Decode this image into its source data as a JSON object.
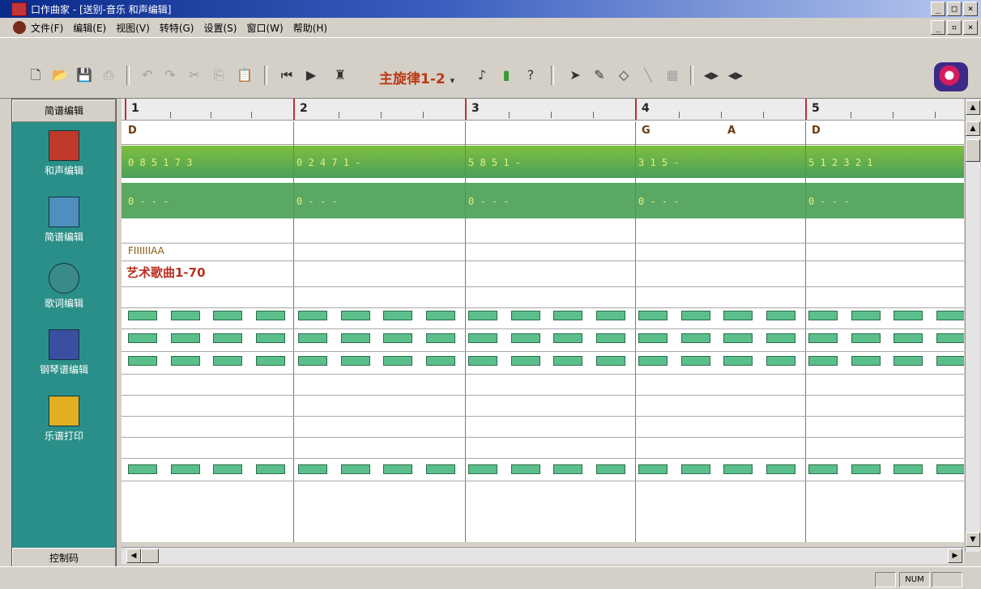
{
  "window": {
    "title": "口作曲家 - [送别-音乐 和声编辑]",
    "minimize": "_",
    "maximize": "□",
    "close": "×"
  },
  "menu": {
    "items": [
      {
        "label": "文件(F)"
      },
      {
        "label": "编辑(E)"
      },
      {
        "label": "视图(V)"
      },
      {
        "label": "转特(G)"
      },
      {
        "label": "设置(S)"
      },
      {
        "label": "窗口(W)"
      },
      {
        "label": "帮助(H)"
      }
    ],
    "doc_buttons": [
      "_",
      "▫",
      "×"
    ]
  },
  "toolbar": {
    "melody_selector": "主旋律1-2",
    "icons": [
      "new-icon",
      "open-icon",
      "save-icon",
      "print-icon",
      "undo-icon",
      "redo-icon",
      "cut-icon",
      "copy-icon",
      "paste-icon",
      "rewind-icon",
      "play-icon",
      "track-icon",
      "select-icon",
      "pencil-icon",
      "eraser-icon",
      "line-icon",
      "grid-icon",
      "zoom-in-icon",
      "zoom-out-icon"
    ]
  },
  "sidebar": {
    "header": "简谱编辑",
    "footer": "控制码",
    "items": [
      {
        "label": "和声编辑",
        "icon": "harmony-icon",
        "color": "#c0392b"
      },
      {
        "label": "简谱编辑",
        "icon": "notation-icon",
        "color": "#4f8fbf"
      },
      {
        "label": "歌词编辑",
        "icon": "lyrics-icon",
        "color": "#3a8a8a"
      },
      {
        "label": "钢琴谱编辑",
        "icon": "piano-score-icon",
        "color": "#3b4fa0"
      },
      {
        "label": "乐谱打印",
        "icon": "print-score-icon",
        "color": "#e0b020"
      }
    ]
  },
  "editor": {
    "bars": [
      "1",
      "2",
      "3",
      "4",
      "5"
    ],
    "chords": [
      "D",
      "G",
      "A",
      "D"
    ],
    "melody_row_1": [
      "0  8 5 1   7 3",
      "0 2 4 7 1   -",
      "5  8 5 1    -",
      "3  1   5   -",
      "5  1 2 3  2 1"
    ],
    "melody_row_2": [
      "0  -   -   -",
      "0  -   -   -",
      "0  -   -   -",
      "0  -   -   -",
      "0  -   -   -"
    ],
    "track_name": "FIIIIIIAA",
    "lyric": "艺术歌曲1-70"
  },
  "status": {
    "num": "NUM"
  },
  "colors": {
    "accent": "#b83a14",
    "sidebar": "#2a8f88",
    "green_row": "#5aa864"
  }
}
